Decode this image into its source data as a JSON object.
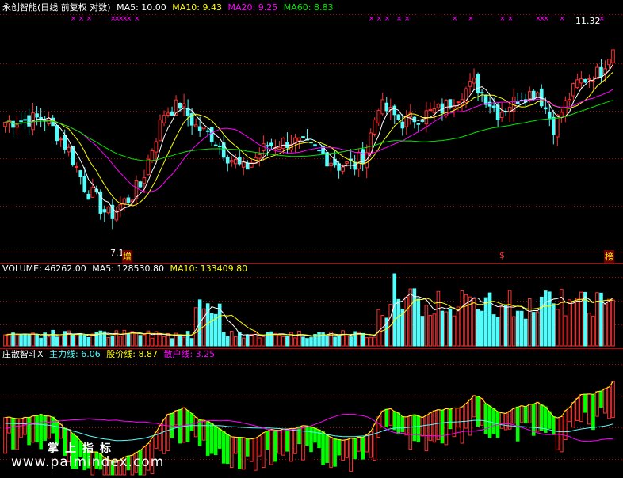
{
  "colors": {
    "up": "#ff3232",
    "down": "#54fcfc",
    "ma5": "#ffffff",
    "ma10": "#ffff00",
    "ma20": "#ff00ff",
    "ma60": "#00e600",
    "grid": "#b00000",
    "separator": "#c00000"
  },
  "main_header": {
    "title": "永创智能(日线 前复权 对数)",
    "ma5": "MA5: 10.00",
    "ma10": "MA10: 9.43",
    "ma20": "MA20: 9.25",
    "ma60": "MA60: 8.83"
  },
  "volume_header": {
    "title": "VOLUME: 46262.00",
    "ma5": "MA5: 128530.80",
    "ma10": "MA10: 133409.80"
  },
  "indicator_header": {
    "title": "庄散智斗X",
    "main": "主力线: 6.06",
    "price": "股价线: 8.87",
    "retail": "散户线: 3.25"
  },
  "annotations": {
    "high_label": "11.32",
    "low_label": "7.1",
    "badge_1": "增",
    "badge_2": "$",
    "badge_3": "榜"
  },
  "watermark": {
    "line1": "掌上指标",
    "line2": "www.palmindex.com"
  },
  "chart_data": [
    {
      "type": "candlestick",
      "title": "永创智能(日线 前复权 对数)",
      "scale": "log",
      "ylim": [
        6.6,
        11.9
      ],
      "max_label": 11.32,
      "min_label": 7.1,
      "grid": true,
      "note": "values estimated; annotation: 11.32 high, 7.1 low"
    },
    {
      "type": "bar",
      "title": "VOLUME: 46262.00",
      "series": [
        "VOLUME",
        "MA5",
        "MA10"
      ],
      "last_values": {
        "VOLUME": 46262.0,
        "MA5": 128530.8,
        "MA10": 133409.8
      }
    },
    {
      "type": "line",
      "title": "庄散智斗X",
      "series": [
        "主力线",
        "股价线",
        "散户线"
      ],
      "last_values": {
        "主力线": 6.06,
        "股价线": 8.87,
        "散户线": 3.25
      }
    }
  ]
}
